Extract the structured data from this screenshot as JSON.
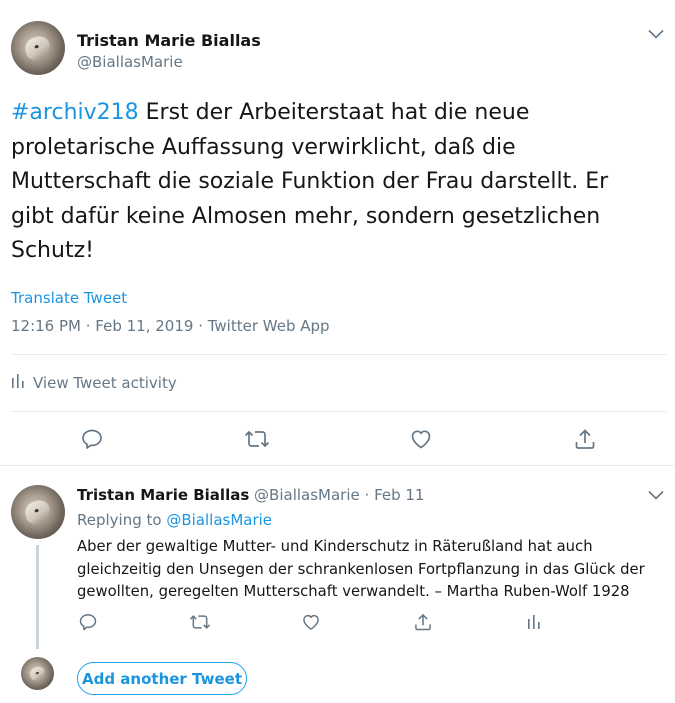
{
  "main_tweet": {
    "author_name": "Tristan Marie Biallas",
    "author_handle": "@BiallasMarie",
    "hashtag": "#archiv218",
    "text": " Erst der Arbeiterstaat hat die neue proletarische Auffassung verwirklicht, daß die Mutterschaft die soziale Funktion der Frau darstellt. Er gibt dafür keine Almosen mehr, sondern gesetzlichen Schutz!",
    "translate_label": "Translate Tweet",
    "time": "12:16 PM",
    "date": "Feb 11, 2019",
    "source": "Twitter Web App",
    "separator": " · ",
    "activity_label": "View Tweet activity"
  },
  "reply_tweet": {
    "author_name": "Tristan Marie Biallas",
    "author_handle": "@BiallasMarie",
    "separator": " · ",
    "date": "Feb 11",
    "replying_prefix": "Replying to ",
    "replying_to": "@BiallasMarie",
    "text": "Aber der gewaltige Mutter- und Kinderschutz in Räterußland hat auch gleichzeitig den Unsegen der schrankenlosen Fortpflanzung in das Glück der gewollten, geregelten Mutterschaft verwandelt. – Martha Ruben-Wolf 1928"
  },
  "compose": {
    "add_tweet_label": "Add another Tweet"
  },
  "icons": {
    "caret": "chevron-down-icon",
    "reply": "reply-icon",
    "retweet": "retweet-icon",
    "like": "heart-icon",
    "share": "share-icon",
    "analytics": "analytics-icon"
  },
  "colors": {
    "link": "#1b95e0",
    "secondary_text": "#657786",
    "primary_text": "#14171a",
    "divider": "#e6ecf0"
  }
}
